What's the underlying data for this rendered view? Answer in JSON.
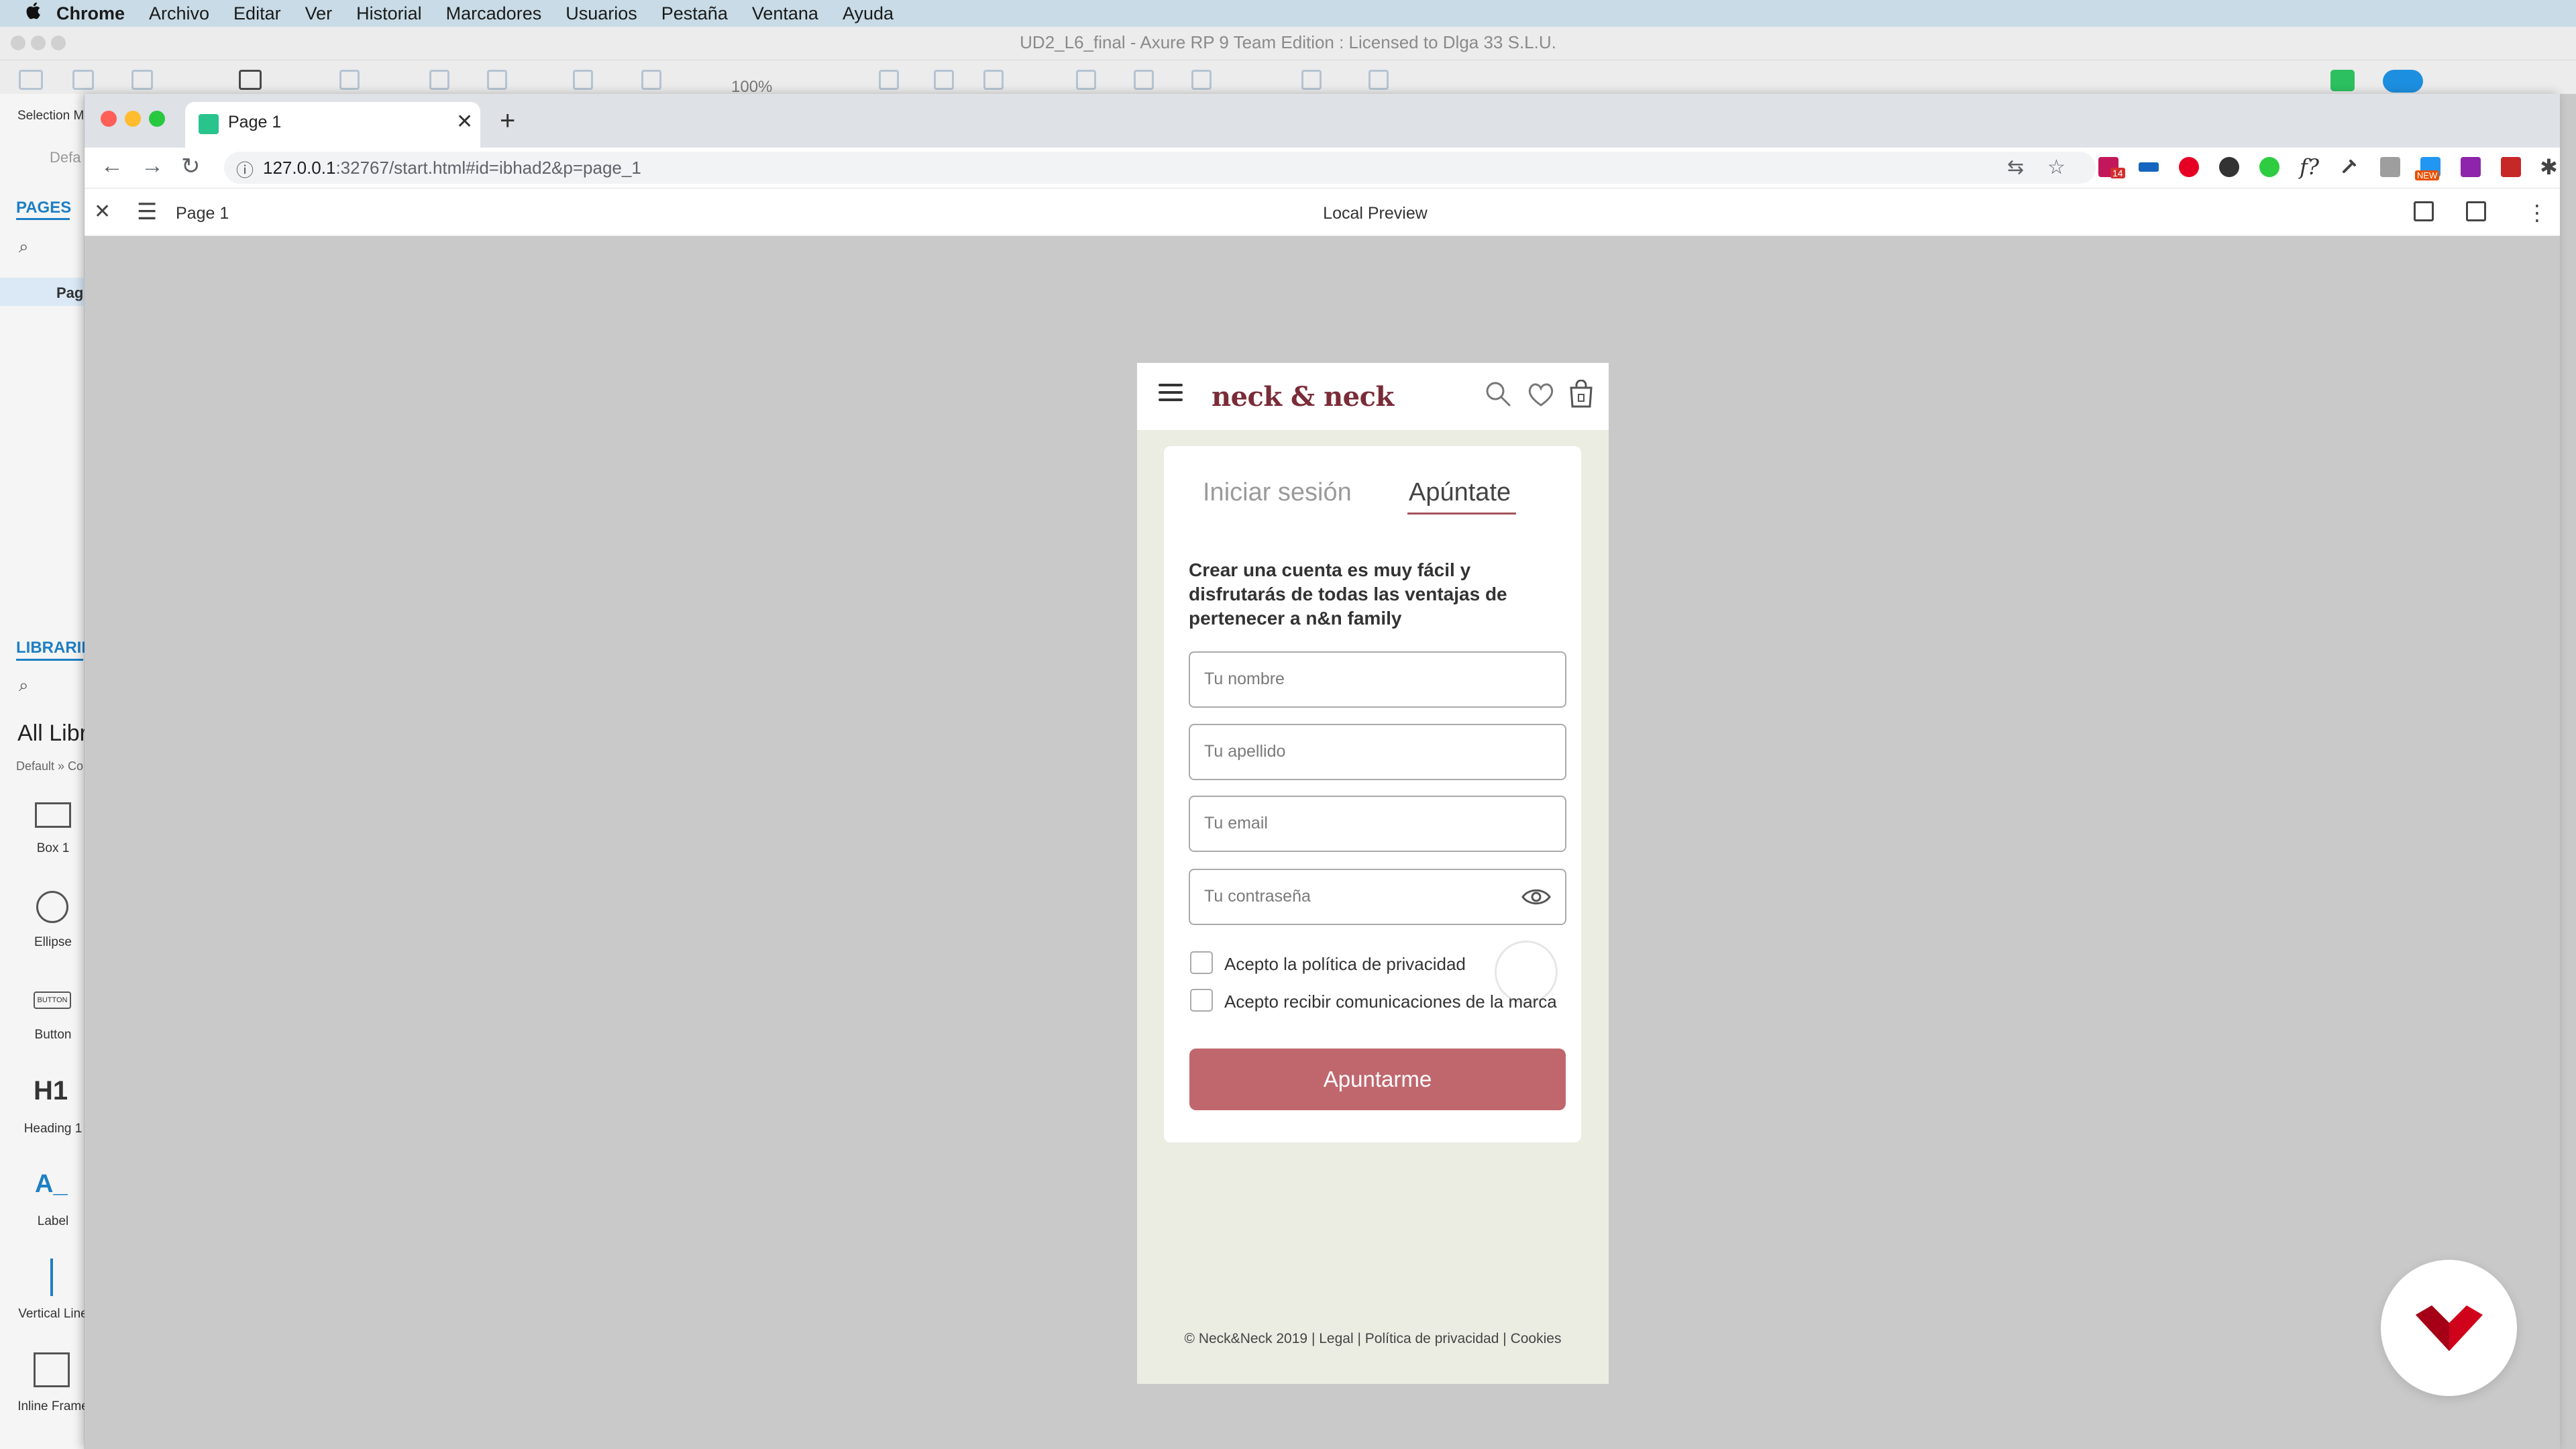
{
  "menubar": {
    "apple": "",
    "app": "Chrome",
    "items": [
      "Archivo",
      "Editar",
      "Ver",
      "Historial",
      "Marcadores",
      "Usuarios",
      "Pestaña",
      "Ventana",
      "Ayuda"
    ]
  },
  "axure": {
    "window_title": "UD2_L6_final - Axure RP 9 Team Edition : Licensed to Dlga 33 S.L.U.",
    "zoom": "100%",
    "selection_mode": "Selection Mo",
    "default_label": "Defa",
    "pages_tab": "PAGES",
    "page_item": "Pag",
    "libraries_tab": "LIBRARIE",
    "all_libraries": "All Libr",
    "library_path": "Default » Co",
    "widgets": [
      {
        "label": "Box 1",
        "icon": "box-icon"
      },
      {
        "label": "Ellipse",
        "icon": "ellipse-icon"
      },
      {
        "label": "Button",
        "icon": "button-icon"
      },
      {
        "label": "Heading 1",
        "icon": "heading-icon"
      },
      {
        "label": "Label",
        "icon": "label-icon"
      },
      {
        "label": "Vertical Line",
        "icon": "vertical-line-icon"
      },
      {
        "label": "Inline Frame",
        "icon": "inline-frame-icon"
      }
    ],
    "widget_glyphs": {
      "button": "BUTTON",
      "heading": "H1",
      "label": "A_"
    }
  },
  "browser": {
    "tab_title": "Page 1",
    "tab_close": "✕",
    "new_tab": "+",
    "back": "←",
    "forward": "→",
    "reload": "↻",
    "info": "ⓘ",
    "url_host": "127.0.0.1",
    "url_rest": ":32767/start.html#id=ibhad2&p=page_1",
    "translate": "⇆",
    "star": "☆",
    "extension_badge_new": "NEW",
    "extension_badge_count": "14"
  },
  "preview": {
    "close": "✕",
    "menu": "☰",
    "page": "Page 1",
    "title": "Local Preview",
    "more": "⋮"
  },
  "site": {
    "brand": "neck & neck",
    "search_icon": "⌕",
    "heart_icon": "♡",
    "tabs": {
      "login": "Iniciar sesión",
      "signup": "Apúntate"
    },
    "intro": "Crear una cuenta es muy fácil y disfrutarás de todas las ventajas de pertenecer a n&n family",
    "fields": {
      "nombre": "Tu nombre",
      "apellido": "Tu apellido",
      "email": "Tu email",
      "password": "Tu contraseña"
    },
    "checkboxes": {
      "privacy": "Acepto la política de privacidad",
      "comms": "Acepto recibir comunicaciones de la marca"
    },
    "submit": "Apuntarme",
    "footer": {
      "copyright": "© Neck&Neck 2019",
      "sep": "|",
      "legal": "Legal",
      "privacy": "Política de privacidad",
      "cookies": "Cookies"
    },
    "colors": {
      "brand": "#7a2c37",
      "button": "#c0676e",
      "background": "#ebede3"
    }
  }
}
